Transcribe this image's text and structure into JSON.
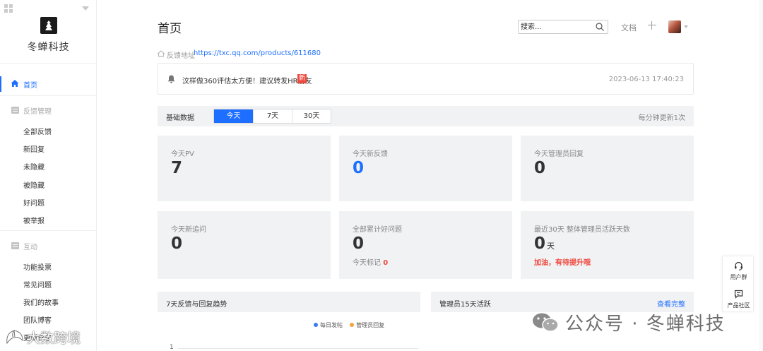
{
  "sidebar": {
    "brand": "冬蝉科技",
    "home_label": "首页",
    "sections": [
      {
        "label": "反馈管理",
        "items": [
          "全部反馈",
          "新回复",
          "未隐藏",
          "被隐藏",
          "好问题",
          "被举报"
        ]
      },
      {
        "label": "互动",
        "items": [
          "功能投票",
          "常见问题",
          "我们的故事",
          "团队博客",
          "更新日志"
        ]
      }
    ]
  },
  "header": {
    "title": "首页",
    "search_placeholder": "搜索...",
    "docs_label": "文档"
  },
  "feedback_address": {
    "label": "反馈地址",
    "url": "https://txc.qq.com/products/611680"
  },
  "notice": {
    "text": "汶样做360评估太方便！建议转发HR朋友",
    "badge": "新",
    "time": "2023-06-13 17:40:23"
  },
  "basic_data": {
    "title": "基础数据",
    "tabs": [
      "今天",
      "7天",
      "30天"
    ],
    "active_tab": "今天",
    "update_note": "每分钟更新1次"
  },
  "stats": [
    {
      "label": "今天PV",
      "value": "7"
    },
    {
      "label": "今天新反馈",
      "value": "0"
    },
    {
      "label": "今天管理员回复",
      "value": "0"
    },
    {
      "label": "今天新追问",
      "value": "0"
    },
    {
      "label": "全部累计好问题",
      "value": "0",
      "sub_label": "今天标记",
      "sub_value": "0"
    },
    {
      "label": "最近30天 整体管理员活跃天数",
      "value": "0",
      "unit": "天",
      "warning": "加油，有待提升哦"
    }
  ],
  "trend_panel": {
    "title": "7天反馈与回复趋势",
    "legend": [
      {
        "name": "每日发帖",
        "color": "#3a7bf2"
      },
      {
        "name": "管理员回复",
        "color": "#f5a342"
      }
    ],
    "axis_top_value": "1"
  },
  "admin_panel": {
    "title": "管理员15天活跃",
    "link": "查看完整"
  },
  "float_tools": {
    "user_group": "用户群",
    "community": "产品社区"
  },
  "watermarks": {
    "wechat": "公众号 · 冬蝉科技",
    "left": "大数跨境"
  },
  "colors": {
    "accent": "#1e6fff",
    "danger": "#f0483f",
    "panel_bg": "#f1f2f4"
  }
}
